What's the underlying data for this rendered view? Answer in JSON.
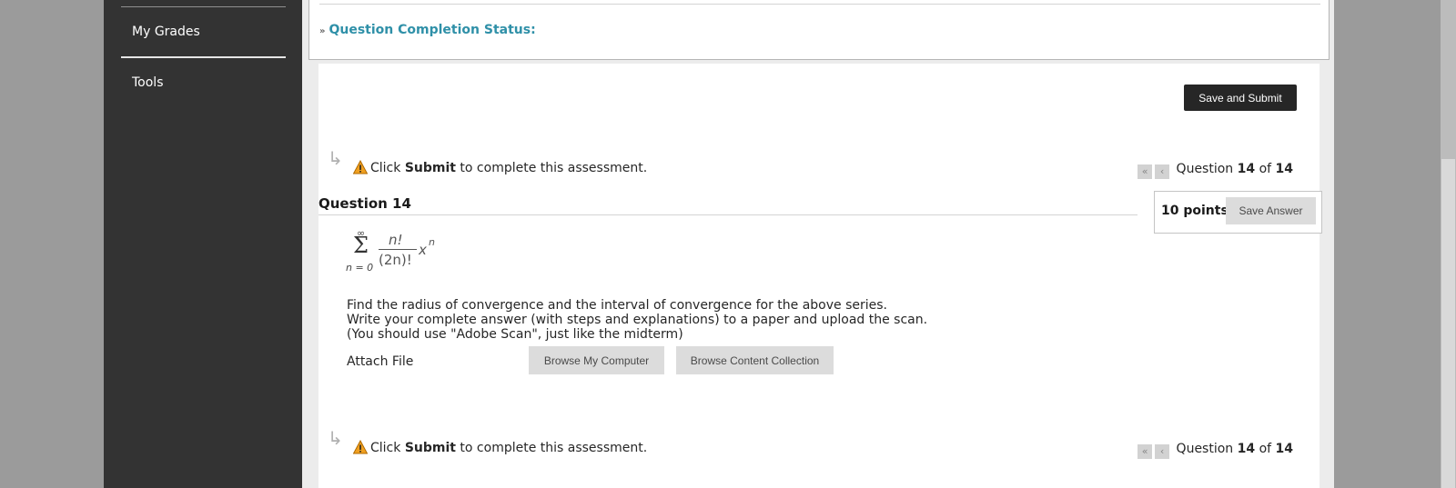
{
  "nav": {
    "items": [
      "My Grades",
      "Tools"
    ]
  },
  "status": {
    "label": "Question Completion Status:"
  },
  "actions": {
    "save_submit": "Save and Submit",
    "save_answer": "Save Answer"
  },
  "notice": {
    "prefix": "Click",
    "bold": "Submit",
    "suffix": "to complete this assessment."
  },
  "pager": {
    "prefix": "Question",
    "current": "14",
    "of": "of",
    "total": "14",
    "first_icon": "double-chevron-left-icon",
    "prev_icon": "chevron-left-icon"
  },
  "question": {
    "title": "Question 14",
    "points": "10 points",
    "formula": {
      "sum_top": "∞",
      "sum_bottom": "n = 0",
      "numerator": "n!",
      "denominator": "(2n)!",
      "term": "x",
      "exponent": "n"
    },
    "lines": [
      "Find the radius of convergence and the interval of convergence for the above series.",
      "Write your complete answer (with steps and explanations) to a paper and upload the scan.",
      "(You should use \"Adobe Scan\", just like the midterm)"
    ],
    "attach_label": "Attach File",
    "browse_computer": "Browse My Computer",
    "browse_collection": "Browse Content Collection"
  }
}
